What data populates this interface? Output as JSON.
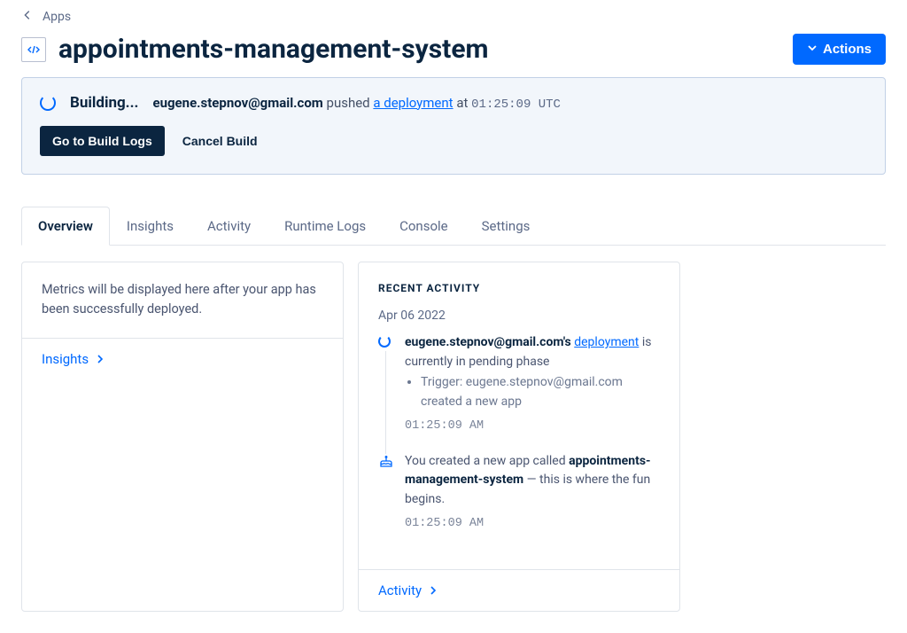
{
  "breadcrumb": {
    "back_label": "Apps"
  },
  "header": {
    "app_name": "appointments-management-system",
    "actions_label": "Actions"
  },
  "build_banner": {
    "status": "Building...",
    "email": "eugene.stepnov@gmail.com",
    "pushed_text": "pushed",
    "deployment_link": "a deployment",
    "at_text": "at",
    "time": "01:25:09 UTC",
    "go_logs": "Go to Build Logs",
    "cancel": "Cancel Build"
  },
  "tabs": [
    {
      "label": "Overview",
      "active": true
    },
    {
      "label": "Insights",
      "active": false
    },
    {
      "label": "Activity",
      "active": false
    },
    {
      "label": "Runtime Logs",
      "active": false
    },
    {
      "label": "Console",
      "active": false
    },
    {
      "label": "Settings",
      "active": false
    }
  ],
  "overview_card": {
    "text": "Metrics will be displayed here after your app has been successfully deployed.",
    "insights_link": "Insights"
  },
  "activity_card": {
    "title": "RECENT ACTIVITY",
    "date": "Apr 06 2022",
    "items": [
      {
        "email_bold": "eugene.stepnov@gmail.com's",
        "deployment_link": "deployment",
        "tail": "is currently in pending phase",
        "trigger_prefix": "Trigger:",
        "trigger_text": "eugene.stepnov@gmail.com created a new app",
        "time": "01:25:09 AM"
      },
      {
        "prefix": "You created a new app called",
        "app_bold": "appointments-management-system",
        "suffix": "— this is where the fun begins.",
        "time": "01:25:09 AM"
      }
    ],
    "activity_link": "Activity"
  }
}
